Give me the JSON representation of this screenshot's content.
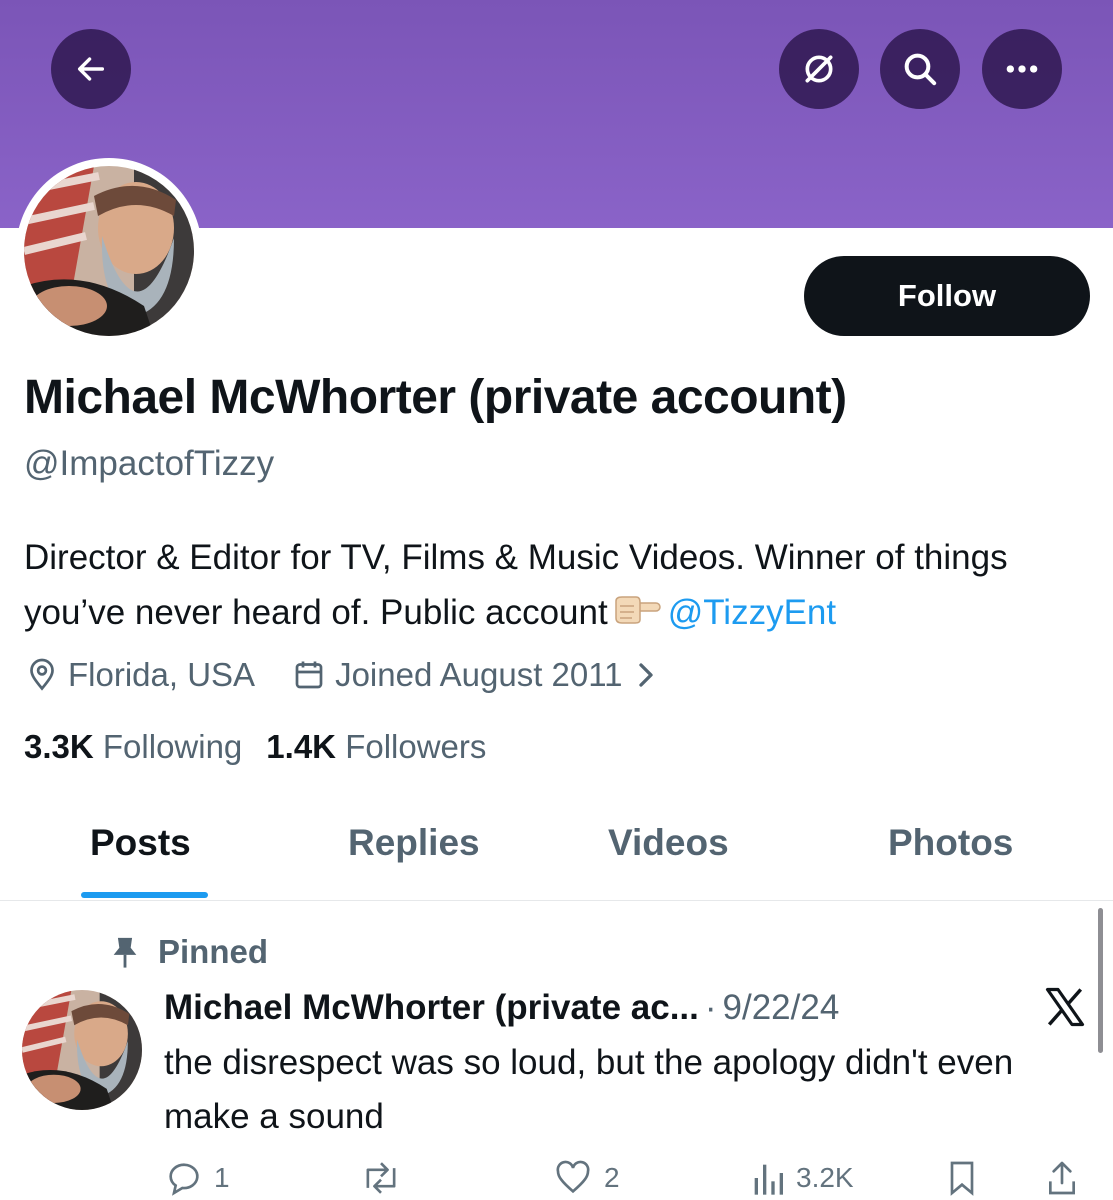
{
  "header": {
    "back_icon": "arrow-left-icon",
    "translate_icon": "slashed-circle-icon",
    "search_icon": "search-icon",
    "more_icon": "ellipsis-icon",
    "banner_color": "#8a63c8"
  },
  "profile": {
    "follow_label": "Follow",
    "name": "Michael McWhorter (private account)",
    "handle": "@ImpactofTizzy",
    "bio_text": "Director & Editor for TV, Films & Music Videos. Winner of things you’ve never heard of. Public account",
    "bio_mention": "@TizzyEnt",
    "location": "Florida, USA",
    "joined": "Joined August 2011",
    "following_count": "3.3K",
    "following_label": "Following",
    "followers_count": "1.4K",
    "followers_label": "Followers"
  },
  "tabs": [
    {
      "label": "Posts",
      "active": true
    },
    {
      "label": "Replies",
      "active": false
    },
    {
      "label": "Videos",
      "active": false
    },
    {
      "label": "Photos",
      "active": false
    }
  ],
  "post": {
    "pinned_label": "Pinned",
    "author": "Michael McWhorter (private ac...",
    "separator": "·",
    "date": "9/22/24",
    "text": "the disrespect was so loud, but the apology didn't even make a sound",
    "replies": "1",
    "reposts": "",
    "likes": "2",
    "views": "3.2K"
  },
  "colors": {
    "accent": "#1d9bf0",
    "text": "#0f1419",
    "muted": "#536471"
  }
}
